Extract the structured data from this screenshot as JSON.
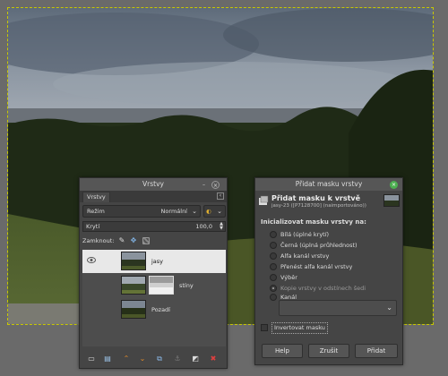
{
  "layers_dialog": {
    "title": "Vrstvy",
    "tab_label": "Vrstvy",
    "mode_label": "Režim",
    "mode_value": "Normální",
    "opacity_label": "Krytí",
    "opacity_value": "100,0",
    "lock_label": "Zamknout:",
    "layers": [
      {
        "name": "jasy",
        "selected": true
      },
      {
        "name": "stíny",
        "selected": false
      },
      {
        "name": "Pozadí",
        "selected": false
      }
    ]
  },
  "mask_dialog": {
    "window_title": "Přidat masku vrstvy",
    "heading": "Přidat masku k vrstvě",
    "subheading": "jasy-23 ([P7128700] (naimportováno))",
    "init_label": "Inicializovat masku vrstvy na:",
    "options": [
      {
        "label": "Bílá (úplné krytí)",
        "checked": false,
        "disabled": false
      },
      {
        "label": "Černá (úplná průhlednost)",
        "checked": false,
        "disabled": false
      },
      {
        "label": "Alfa kanál vrstvy",
        "checked": false,
        "disabled": false
      },
      {
        "label": "Přenést alfa kanál vrstvy",
        "checked": false,
        "disabled": false
      },
      {
        "label": "Výběr",
        "checked": false,
        "disabled": false
      },
      {
        "label": "Kopie vrstvy v odstínech šedi",
        "checked": true,
        "disabled": true
      },
      {
        "label": "Kanál",
        "checked": false,
        "disabled": false
      }
    ],
    "invert_label": "Invertovat masku",
    "buttons": {
      "help": "Help",
      "cancel": "Zrušit",
      "add": "Přidat"
    }
  },
  "colors": {
    "dialog_bg": "#454545",
    "selection_yellow": "#c8c800",
    "close_green": "#4caf50"
  }
}
